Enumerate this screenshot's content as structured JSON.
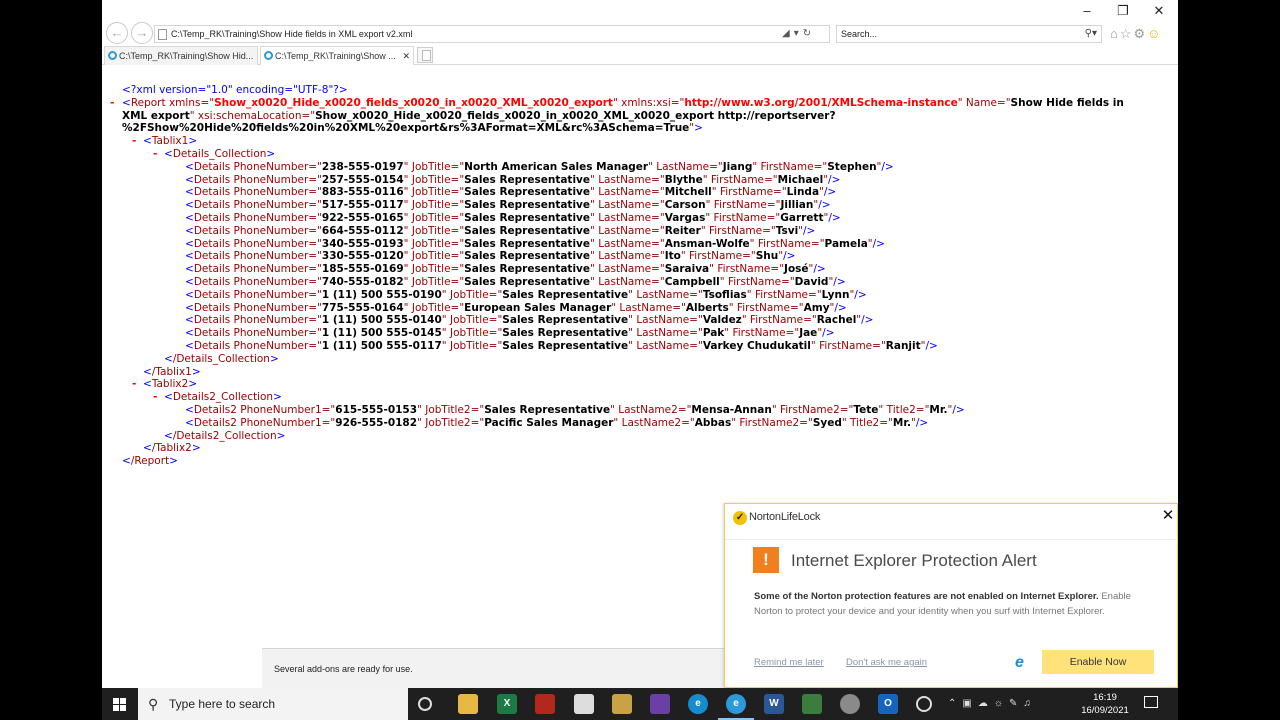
{
  "browser": {
    "address": "C:\\Temp_RK\\Training\\Show Hide fields in XML export v2.xml",
    "search_placeholder": "Search...",
    "tabs": [
      {
        "label": "C:\\Temp_RK\\Training\\Show Hid...",
        "active": false
      },
      {
        "label": "C:\\Temp_RK\\Training\\Show ...",
        "active": true
      }
    ]
  },
  "xml": {
    "declaration": "<?xml version=\"1.0\" encoding=\"UTF-8\"?>",
    "report": {
      "xmlns": "Show_x0020_Hide_x0020_fields_x0020_in_x0020_XML_x0020_export",
      "xmlns_xsi": "http://www.w3.org/2001/XMLSchema-instance",
      "name": "Show Hide fields in XML export",
      "schema_location": "Show_x0020_Hide_x0020_fields_x0020_in_x0020_XML_x0020_export http://reportserver?%2FShow%20Hide%20fields%20in%20XML%20export&rs%3AFormat=XML&rc%3ASchema=True"
    },
    "details": [
      {
        "phone": "238-555-0197",
        "job": "North American Sales Manager",
        "last": "Jiang",
        "first": "Stephen"
      },
      {
        "phone": "257-555-0154",
        "job": "Sales Representative",
        "last": "Blythe",
        "first": "Michael"
      },
      {
        "phone": "883-555-0116",
        "job": "Sales Representative",
        "last": "Mitchell",
        "first": "Linda"
      },
      {
        "phone": "517-555-0117",
        "job": "Sales Representative",
        "last": "Carson",
        "first": "Jillian"
      },
      {
        "phone": "922-555-0165",
        "job": "Sales Representative",
        "last": "Vargas",
        "first": "Garrett"
      },
      {
        "phone": "664-555-0112",
        "job": "Sales Representative",
        "last": "Reiter",
        "first": "Tsvi"
      },
      {
        "phone": "340-555-0193",
        "job": "Sales Representative",
        "last": "Ansman-Wolfe",
        "first": "Pamela"
      },
      {
        "phone": "330-555-0120",
        "job": "Sales Representative",
        "last": "Ito",
        "first": "Shu"
      },
      {
        "phone": "185-555-0169",
        "job": "Sales Representative",
        "last": "Saraiva",
        "first": "José"
      },
      {
        "phone": "740-555-0182",
        "job": "Sales Representative",
        "last": "Campbell",
        "first": "David"
      },
      {
        "phone": "1 (11) 500 555-0190",
        "job": "Sales Representative",
        "last": "Tsoflias",
        "first": "Lynn"
      },
      {
        "phone": "775-555-0164",
        "job": "European Sales Manager",
        "last": "Alberts",
        "first": "Amy"
      },
      {
        "phone": "1 (11) 500 555-0140",
        "job": "Sales Representative",
        "last": "Valdez",
        "first": "Rachel"
      },
      {
        "phone": "1 (11) 500 555-0145",
        "job": "Sales Representative",
        "last": "Pak",
        "first": "Jae"
      },
      {
        "phone": "1 (11) 500 555-0117",
        "job": "Sales Representative",
        "last": "Varkey Chudukatil",
        "first": "Ranjit"
      }
    ],
    "details2": [
      {
        "phone": "615-555-0153",
        "job": "Sales Representative",
        "last": "Mensa-Annan",
        "first": "Tete",
        "title": "Mr."
      },
      {
        "phone": "926-555-0182",
        "job": "Pacific Sales Manager",
        "last": "Abbas",
        "first": "Syed",
        "title": "Mr."
      }
    ]
  },
  "notification_bar": {
    "text": "Several add-ons are ready for use."
  },
  "norton": {
    "brand": "NortonLifeLock",
    "title": "Internet Explorer Protection Alert",
    "body_bold": "Some of the Norton protection features are not enabled on Internet Explorer.",
    "body_rest": " Enable Norton to protect your device and your identity when you surf with Internet Explorer.",
    "remind_label": "Remind me later",
    "dont_ask_label": "Don't ask me again",
    "enable_label": "Enable Now"
  },
  "taskbar": {
    "search_placeholder": "Type here to search",
    "time": "16:19",
    "date": "16/09/2021"
  }
}
